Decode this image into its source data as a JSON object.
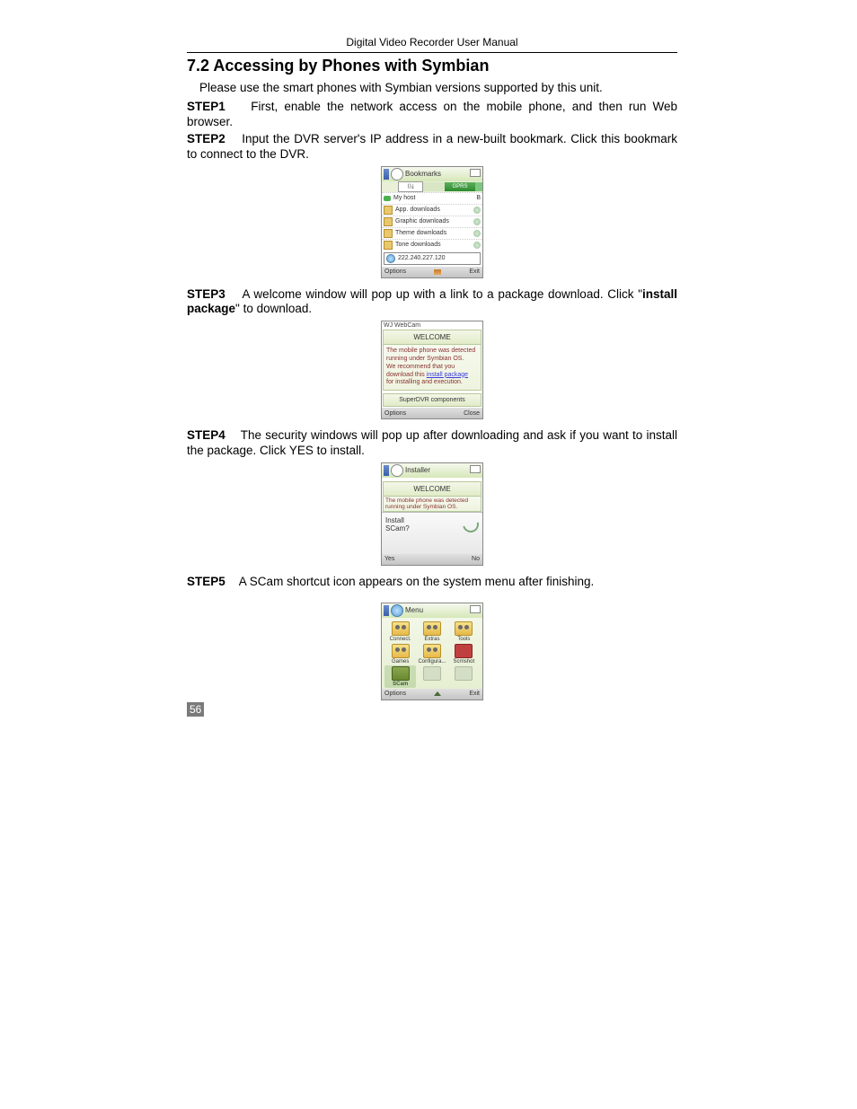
{
  "header": "Digital Video Recorder User Manual",
  "section_title": "7.2  Accessing by Phones with Symbian",
  "intro": "Please use the smart phones with Symbian versions supported by this unit.",
  "steps": {
    "s1": {
      "label": "STEP1",
      "text": "First, enable the network access on the mobile phone, and then run Web browser."
    },
    "s2": {
      "label": "STEP2",
      "text": "Input the DVR server's IP address in a new-built bookmark. Click this bookmark to connect to the DVR."
    },
    "s3": {
      "label": "STEP3",
      "pre": "A welcome window will pop up with a link to a package download. Click \"",
      "bold": "install package",
      "post": "\" to download."
    },
    "s4": {
      "label": "STEP4",
      "text": "The security windows will pop up after downloading and ask if you want to install the package. Click YES to install."
    },
    "s5": {
      "label": "STEP5",
      "text": "A SCam shortcut icon appears on the system menu after finishing."
    }
  },
  "fig1": {
    "title": "Bookmarks",
    "browse": "⟨⟩⤓",
    "gprs": "GPRS",
    "rows": [
      {
        "label": "My host",
        "kind": "push",
        "end": "B"
      },
      {
        "label": "App. downloads",
        "kind": "folder"
      },
      {
        "label": "Graphic downloads",
        "kind": "folder"
      },
      {
        "label": "Theme downloads",
        "kind": "folder"
      },
      {
        "label": "Tone downloads",
        "kind": "folder"
      }
    ],
    "ip": "222.240.227.120",
    "left": "Options",
    "right": "Exit"
  },
  "fig2": {
    "topline": "WJ WebCam",
    "welcome": "WELCOME",
    "line1": "The mobile phone was detected",
    "line2": "running under Symbian OS.",
    "line3": "We recommend that you",
    "line4_pre": "download this ",
    "line4_link": "install package",
    "line5": "for installing and execution.",
    "components": "SuperDVR components",
    "left": "Options",
    "right": "Close"
  },
  "fig3": {
    "title": "Installer",
    "welcome": "WELCOME",
    "detect1": "The mobile phone was detected",
    "detect2": "running under Symbian OS.",
    "prompt1": "Install",
    "prompt2": "SCam?",
    "left": "Yes",
    "right": "No"
  },
  "fig4": {
    "title": "Menu",
    "items": [
      "Connect.",
      "Extras",
      "Tools",
      "Games",
      "Configura...",
      "Scrnshot",
      "SCam",
      "",
      ""
    ],
    "left": "Options",
    "right": "Exit"
  },
  "page_number": "56"
}
